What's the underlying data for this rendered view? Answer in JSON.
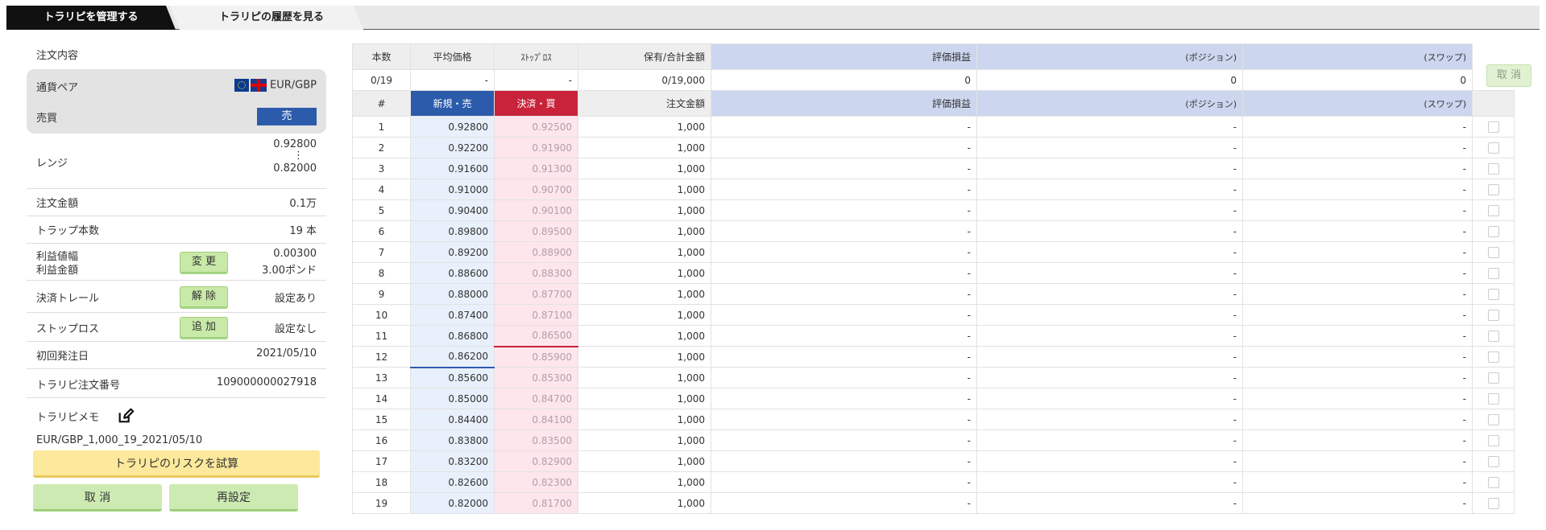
{
  "tabs": [
    {
      "label": "トラリピを管理する",
      "active": true
    },
    {
      "label": "トラリピの履歴を見る",
      "active": false
    }
  ],
  "left": {
    "section_title": "注文内容",
    "currency_pair_label": "通貨ペア",
    "currency_pair_value": "EUR/GBP",
    "side_label": "売買",
    "side_value": "売",
    "range_label": "レンジ",
    "range_high": "0.92800",
    "range_dots": "⋮",
    "range_low": "0.82000",
    "order_amount_label": "注文金額",
    "order_amount_value": "0.1万",
    "trap_count_label": "トラップ本数",
    "trap_count_value": "19 本",
    "profit_width_label": "利益値幅",
    "profit_amount_label": "利益金額",
    "profit_width_value": "0.00300",
    "profit_amount_value": "3.00ポンド",
    "change_button": "変 更",
    "trail_label": "決済トレール",
    "trail_button": "解 除",
    "trail_value": "設定あり",
    "stoploss_label": "ストップロス",
    "stoploss_button": "追 加",
    "stoploss_value": "設定なし",
    "first_order_label": "初回発注日",
    "first_order_value": "2021/05/10",
    "order_no_label": "トラリピ注文番号",
    "order_no_value": "109000000027918",
    "memo_label": "トラリピメモ",
    "memo_value": "EUR/GBP_1,000_19_2021/05/10",
    "risk_button": "トラリピのリスクを試算",
    "cancel_button": "取 消",
    "reset_button": "再設定"
  },
  "summary": {
    "headers": [
      "本数",
      "平均価格",
      "ｽﾄｯﾌﾟﾛｽ",
      "保有/合計金額",
      "評価損益",
      "(ポジション)",
      "(スワップ)"
    ],
    "values": [
      "0/19",
      "-",
      "-",
      "0/19,000",
      "0",
      "0",
      "0"
    ],
    "cancel_button": "取 消"
  },
  "table": {
    "headers": [
      "#",
      "新規・売",
      "決済・買",
      "注文金額",
      "評価損益",
      "(ポジション)",
      "(スワップ)"
    ],
    "rows": [
      [
        "1",
        "0.92800",
        "0.92500",
        "1,000",
        "-",
        "-",
        "-"
      ],
      [
        "2",
        "0.92200",
        "0.91900",
        "1,000",
        "-",
        "-",
        "-"
      ],
      [
        "3",
        "0.91600",
        "0.91300",
        "1,000",
        "-",
        "-",
        "-"
      ],
      [
        "4",
        "0.91000",
        "0.90700",
        "1,000",
        "-",
        "-",
        "-"
      ],
      [
        "5",
        "0.90400",
        "0.90100",
        "1,000",
        "-",
        "-",
        "-"
      ],
      [
        "6",
        "0.89800",
        "0.89500",
        "1,000",
        "-",
        "-",
        "-"
      ],
      [
        "7",
        "0.89200",
        "0.88900",
        "1,000",
        "-",
        "-",
        "-"
      ],
      [
        "8",
        "0.88600",
        "0.88300",
        "1,000",
        "-",
        "-",
        "-"
      ],
      [
        "9",
        "0.88000",
        "0.87700",
        "1,000",
        "-",
        "-",
        "-"
      ],
      [
        "10",
        "0.87400",
        "0.87100",
        "1,000",
        "-",
        "-",
        "-"
      ],
      [
        "11",
        "0.86800",
        "0.86500",
        "1,000",
        "-",
        "-",
        "-"
      ],
      [
        "12",
        "0.86200",
        "0.85900",
        "1,000",
        "-",
        "-",
        "-"
      ],
      [
        "13",
        "0.85600",
        "0.85300",
        "1,000",
        "-",
        "-",
        "-"
      ],
      [
        "14",
        "0.85000",
        "0.84700",
        "1,000",
        "-",
        "-",
        "-"
      ],
      [
        "15",
        "0.84400",
        "0.84100",
        "1,000",
        "-",
        "-",
        "-"
      ],
      [
        "16",
        "0.83800",
        "0.83500",
        "1,000",
        "-",
        "-",
        "-"
      ],
      [
        "17",
        "0.83200",
        "0.82900",
        "1,000",
        "-",
        "-",
        "-"
      ],
      [
        "18",
        "0.82600",
        "0.82300",
        "1,000",
        "-",
        "-",
        "-"
      ],
      [
        "19",
        "0.82000",
        "0.81700",
        "1,000",
        "-",
        "-",
        "-"
      ]
    ]
  },
  "colors": {
    "sell_blue": "#2c5bab",
    "buy_red": "#c8233b",
    "green_button": "#c8e9a7",
    "yellow_button": "#fde99c"
  }
}
